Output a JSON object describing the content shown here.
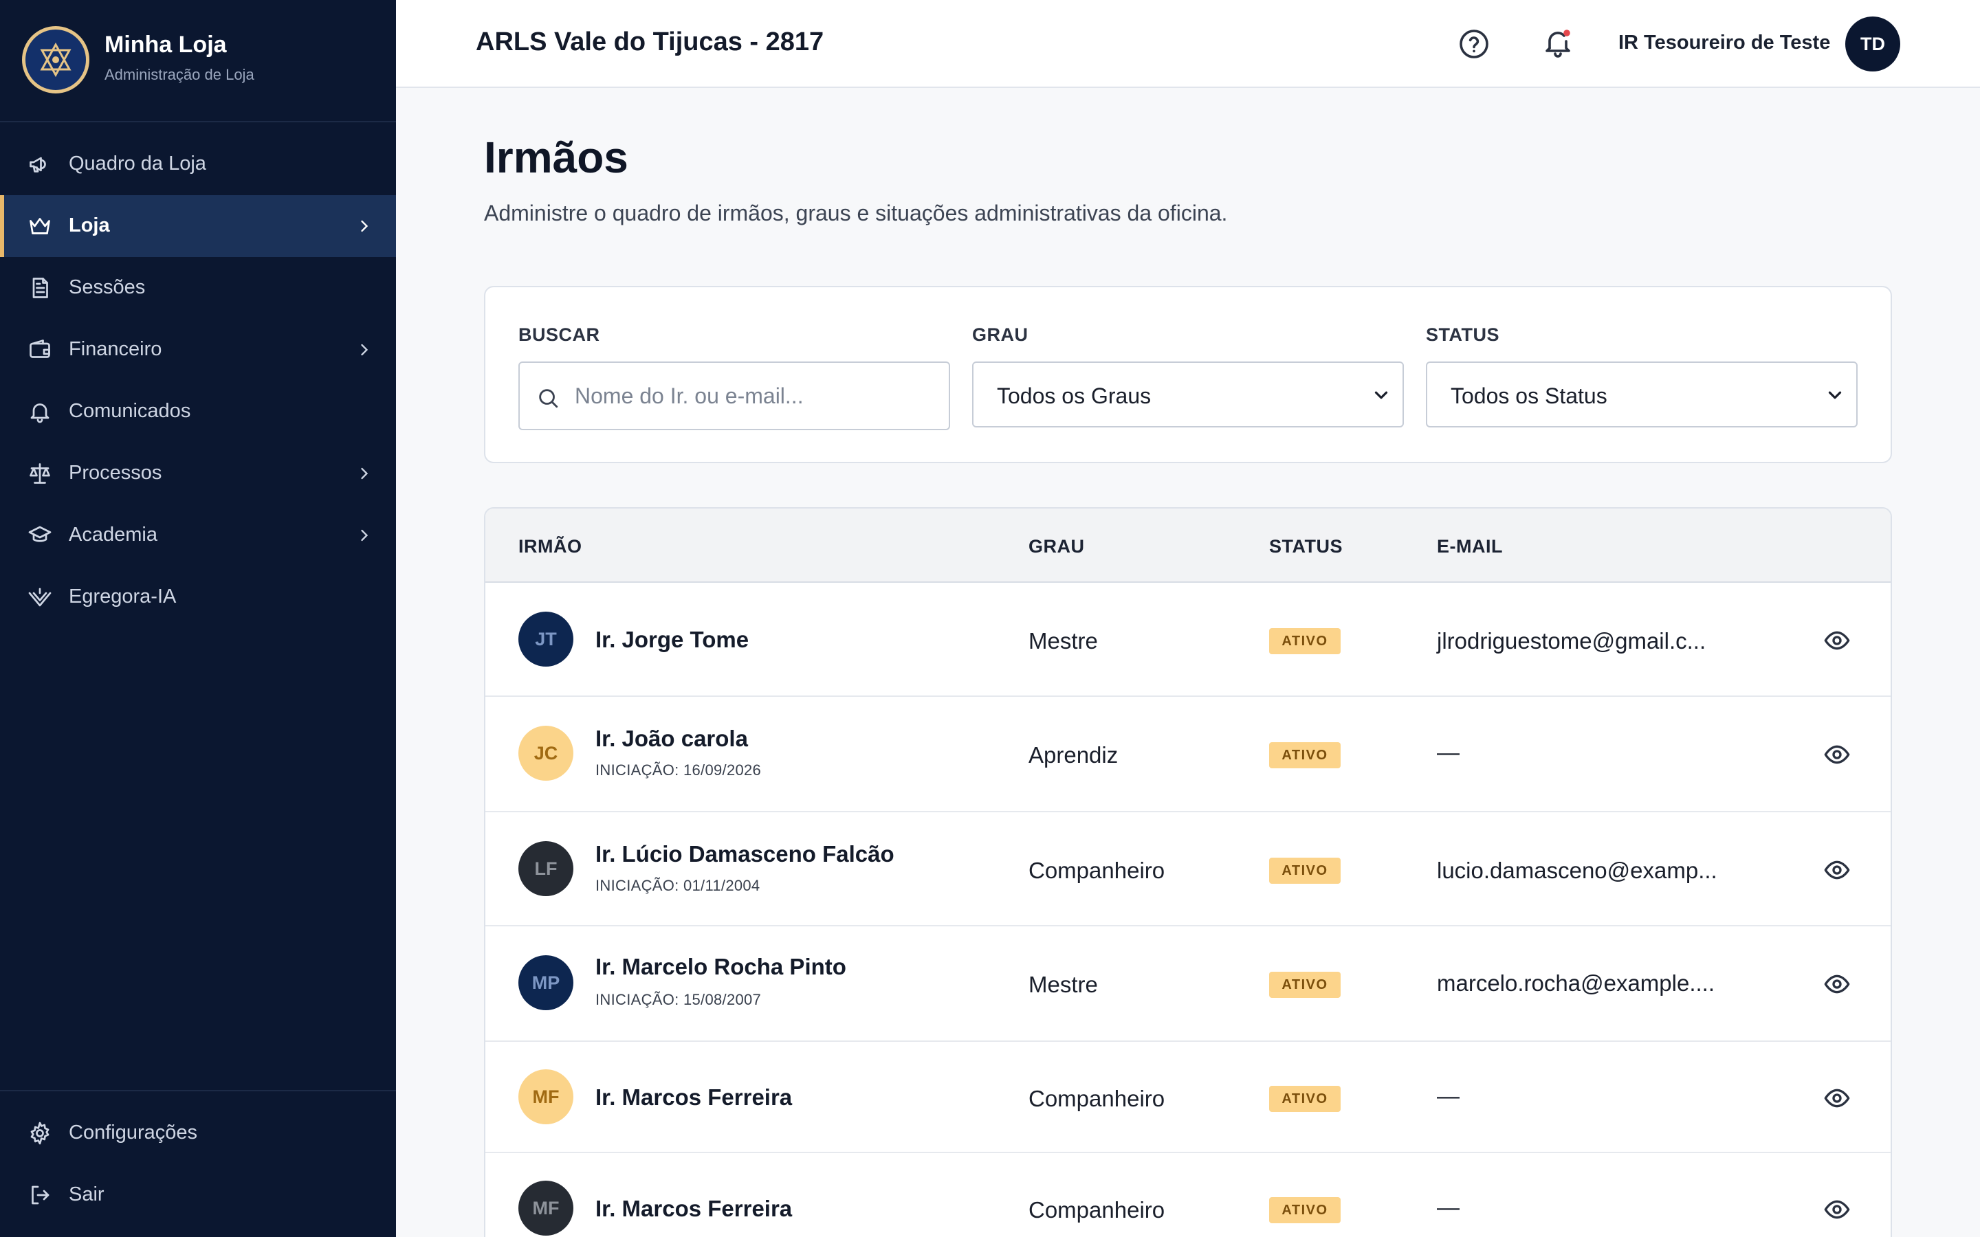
{
  "brand": {
    "name": "Minha Loja",
    "subtitle": "Administração de Loja"
  },
  "nav": {
    "items": [
      {
        "label": "Quadro da Loja",
        "icon": "megaphone-icon",
        "chevron": false,
        "active": false
      },
      {
        "label": "Loja",
        "icon": "crown-icon",
        "chevron": true,
        "active": true
      },
      {
        "label": "Sessões",
        "icon": "document-icon",
        "chevron": false,
        "active": false
      },
      {
        "label": "Financeiro",
        "icon": "wallet-icon",
        "chevron": true,
        "active": false
      },
      {
        "label": "Comunicados",
        "icon": "bell-icon",
        "chevron": false,
        "active": false
      },
      {
        "label": "Processos",
        "icon": "scale-icon",
        "chevron": true,
        "active": false
      },
      {
        "label": "Academia",
        "icon": "graduation-cap-icon",
        "chevron": true,
        "active": false
      },
      {
        "label": "Egregora-IA",
        "icon": "compass-icon",
        "chevron": false,
        "active": false
      }
    ],
    "footer": [
      {
        "label": "Configurações",
        "icon": "gear-icon"
      },
      {
        "label": "Sair",
        "icon": "logout-icon"
      }
    ]
  },
  "header": {
    "lodge_title": "ARLS Vale do Tijucas - 2817",
    "user_name": "IR Tesoureiro de Teste",
    "user_initials": "TD",
    "notification_dot_color": "#e5484d"
  },
  "page": {
    "title": "Irmãos",
    "subtitle": "Administre o quadro de irmãos, graus e situações administrativas da oficina."
  },
  "filters": {
    "search_label": "BUSCAR",
    "search_placeholder": "Nome do Ir. ou e-mail...",
    "grau_label": "GRAU",
    "grau_value": "Todos os Graus",
    "status_label": "STATUS",
    "status_value": "Todos os Status"
  },
  "table": {
    "columns": {
      "irmao": "IRMÃO",
      "grau": "GRAU",
      "status": "STATUS",
      "email": "E-MAIL"
    },
    "rows": [
      {
        "initials": "JT",
        "name": "Ir. Jorge Tome",
        "initiation": "",
        "grau": "Mestre",
        "status": "ATIVO",
        "email": "jlrodriguestome@gmail.c...",
        "avatar_style": "navy"
      },
      {
        "initials": "JC",
        "name": "Ir. João carola",
        "initiation": "INICIAÇÃO: 16/09/2026",
        "grau": "Aprendiz",
        "status": "ATIVO",
        "email": "—",
        "avatar_style": "gold"
      },
      {
        "initials": "LF",
        "name": "Ir. Lúcio Damasceno Falcão",
        "initiation": "INICIAÇÃO: 01/11/2004",
        "grau": "Companheiro",
        "status": "ATIVO",
        "email": "lucio.damasceno@examp...",
        "avatar_style": "dark"
      },
      {
        "initials": "MP",
        "name": "Ir. Marcelo Rocha Pinto",
        "initiation": "INICIAÇÃO: 15/08/2007",
        "grau": "Mestre",
        "status": "ATIVO",
        "email": "marcelo.rocha@example....",
        "avatar_style": "navy"
      },
      {
        "initials": "MF",
        "name": "Ir. Marcos Ferreira",
        "initiation": "",
        "grau": "Companheiro",
        "status": "ATIVO",
        "email": "—",
        "avatar_style": "gold"
      },
      {
        "initials": "MF",
        "name": "Ir. Marcos Ferreira",
        "initiation": "",
        "grau": "Companheiro",
        "status": "ATIVO",
        "email": "—",
        "avatar_style": "dark"
      }
    ]
  }
}
